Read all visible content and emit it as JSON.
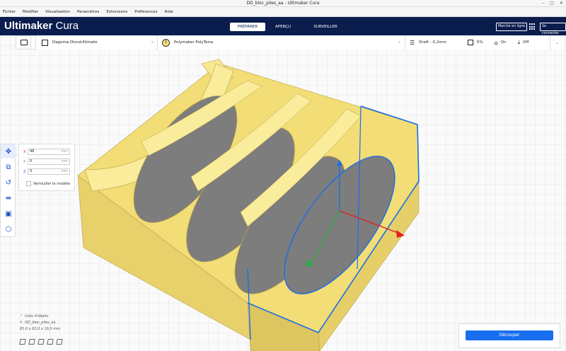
{
  "window": {
    "title": "DD_bloc_piles_aa - Ultimaker Cura"
  },
  "menu": [
    "Fichier",
    "Modifier",
    "Visualisation",
    "Paramètres",
    "Extensions",
    "Préférences",
    "Aide"
  ],
  "header": {
    "logo_bold": "Ultimaker",
    "logo_light": " Cura",
    "stages": [
      "PRÉPARER",
      "APERÇU",
      "SURVEILLER"
    ],
    "marketplace": "Marché en ligne",
    "signin": "Se connecter"
  },
  "toolbar": {
    "printer": "Dagoma DiscoUltimate",
    "material_badge": "1",
    "material": "Polymaker PolyTerra",
    "profile": "Draft - 0.2mm",
    "infill": "5%",
    "support": "On",
    "adhesion": "Off"
  },
  "move_panel": {
    "x_label": "X",
    "x_value": "48",
    "x_unit": "mm",
    "y_label": "Y",
    "y_value": "0",
    "y_unit": "mm",
    "z_label": "Z",
    "z_value": "0",
    "z_unit": "mm",
    "lock_label": "Verrouiller le modèle"
  },
  "object_list": {
    "header": "Liste d'objets",
    "name": "DD_bloc_piles_aa",
    "dims": "65,0 x 63,0 x 18,0 mm"
  },
  "slice": {
    "button": "Découper"
  },
  "colors": {
    "header": "#0a1d4d",
    "accent": "#196ef0",
    "model": "#f5e27d",
    "selection": "#1a6de8"
  },
  "icons": [
    "folder-icon",
    "printer-icon",
    "spool-icon",
    "settings-sliders-icon",
    "infill-icon",
    "support-icon",
    "adhesion-icon",
    "apps-grid-icon",
    "move-icon",
    "scale-icon",
    "rotate-icon",
    "mirror-icon",
    "per-model-settings-icon",
    "support-blocker-icon"
  ]
}
